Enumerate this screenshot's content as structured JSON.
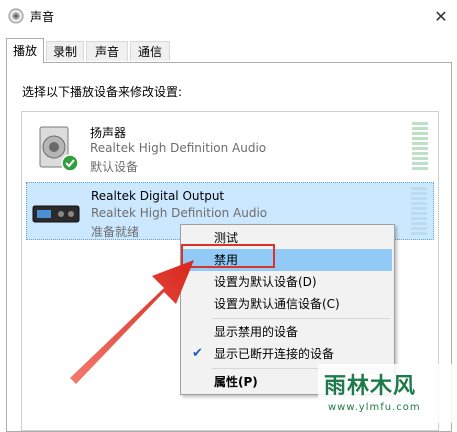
{
  "window": {
    "title": "声音",
    "close_glyph": "✕"
  },
  "tabs": [
    {
      "label": "播放",
      "active": true
    },
    {
      "label": "录制",
      "active": false
    },
    {
      "label": "声音",
      "active": false
    },
    {
      "label": "通信",
      "active": false
    }
  ],
  "instruction": "选择以下播放设备来修改设置:",
  "devices": [
    {
      "name": "扬声器",
      "description": "Realtek High Definition Audio",
      "status": "默认设备",
      "icon": "speaker-icon",
      "default_check": true,
      "selected": false
    },
    {
      "name": "Realtek Digital Output",
      "description": "Realtek High Definition Audio",
      "status": "准备就绪",
      "icon": "digital-output-icon",
      "default_check": false,
      "selected": true
    }
  ],
  "context_menu": {
    "items": [
      {
        "label": "测试"
      },
      {
        "label": "禁用",
        "hover": true
      },
      {
        "label": "设置为默认设备(D)"
      },
      {
        "label": "设置为默认通信设备(C)"
      },
      {
        "label": "显示禁用的设备"
      },
      {
        "label": "显示已断开连接的设备",
        "checked": true
      },
      {
        "label": "属性(P)",
        "bold": true
      }
    ]
  },
  "annotation": {
    "highlight_color": "#d9332b",
    "arrow_color": "#e03a2f"
  },
  "watermark": {
    "main": "雨林木风",
    "sub": "www.ylmfu.com"
  },
  "colors": {
    "selection": "#cce8ff",
    "menu_hover": "#91c9f7"
  }
}
